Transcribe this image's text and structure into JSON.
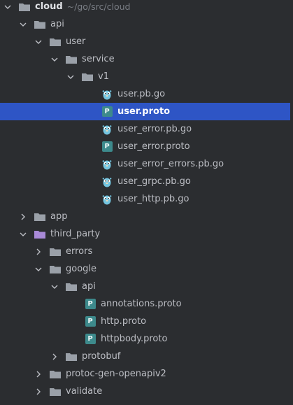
{
  "tree": {
    "root": {
      "label": "cloud",
      "path": "~/go/src/cloud"
    },
    "nodes": [
      {
        "id": "api",
        "label": "api",
        "type": "folder",
        "expanded": true
      },
      {
        "id": "user",
        "label": "user",
        "type": "folder",
        "expanded": true
      },
      {
        "id": "service",
        "label": "service",
        "type": "folder",
        "expanded": true
      },
      {
        "id": "v1",
        "label": "v1",
        "type": "folder",
        "expanded": true
      },
      {
        "id": "user_pb_go",
        "label": "user.pb.go",
        "type": "go-file"
      },
      {
        "id": "user_proto",
        "label": "user.proto",
        "type": "proto-file"
      },
      {
        "id": "user_error_pb_go",
        "label": "user_error.pb.go",
        "type": "go-file"
      },
      {
        "id": "user_error_proto",
        "label": "user_error.proto",
        "type": "proto-file"
      },
      {
        "id": "user_error_errors_pb_go",
        "label": "user_error_errors.pb.go",
        "type": "go-file"
      },
      {
        "id": "user_grpc_pb_go",
        "label": "user_grpc.pb.go",
        "type": "go-file"
      },
      {
        "id": "user_http_pb_go",
        "label": "user_http.pb.go",
        "type": "go-file"
      },
      {
        "id": "app",
        "label": "app",
        "type": "folder",
        "expanded": false
      },
      {
        "id": "third_party",
        "label": "third_party",
        "type": "folder-special",
        "expanded": true
      },
      {
        "id": "errors",
        "label": "errors",
        "type": "folder",
        "expanded": false
      },
      {
        "id": "google",
        "label": "google",
        "type": "folder",
        "expanded": true
      },
      {
        "id": "google_api",
        "label": "api",
        "type": "folder",
        "expanded": true
      },
      {
        "id": "annotations_proto",
        "label": "annotations.proto",
        "type": "proto-file"
      },
      {
        "id": "http_proto",
        "label": "http.proto",
        "type": "proto-file"
      },
      {
        "id": "httpbody_proto",
        "label": "httpbody.proto",
        "type": "proto-file"
      },
      {
        "id": "protobuf",
        "label": "protobuf",
        "type": "folder",
        "expanded": false
      },
      {
        "id": "protoc_gen_openapiv2",
        "label": "protoc-gen-openapiv2",
        "type": "folder",
        "expanded": false
      },
      {
        "id": "validate",
        "label": "validate",
        "type": "folder",
        "expanded": false
      }
    ],
    "proto_icon_letter": "P",
    "selected": "user.proto"
  },
  "colors": {
    "background": "#2b2d30",
    "selection": "#2e55c5",
    "folder": "#9aa0a8",
    "special_folder": "#a98ad8",
    "proto_badge": "#3d8a8c",
    "gopher": "#74c5e0"
  }
}
